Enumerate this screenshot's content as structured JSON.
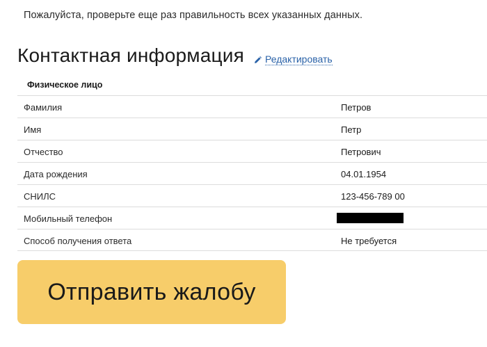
{
  "notice": "Пожалуйста, проверьте еще раз правильность всех указанных данных.",
  "contact": {
    "title": "Контактная информация",
    "edit_label": "Редактировать",
    "subtitle": "Физическое лицо",
    "rows": [
      {
        "label": "Фамилия",
        "value": "Петров"
      },
      {
        "label": "Имя",
        "value": "Петр"
      },
      {
        "label": "Отчество",
        "value": "Петрович"
      },
      {
        "label": "Дата рождения",
        "value": "04.01.1954"
      },
      {
        "label": "СНИЛС",
        "value": "123-456-789 00"
      },
      {
        "label": "Мобильный телефон",
        "value": null
      },
      {
        "label": "Способ получения ответа",
        "value": "Не требуется"
      }
    ]
  },
  "submit_label": "Отправить жалобу",
  "colors": {
    "accent_button": "#f7cd6a",
    "link": "#2a62a8"
  },
  "icons": {
    "edit": "pencil-icon"
  }
}
